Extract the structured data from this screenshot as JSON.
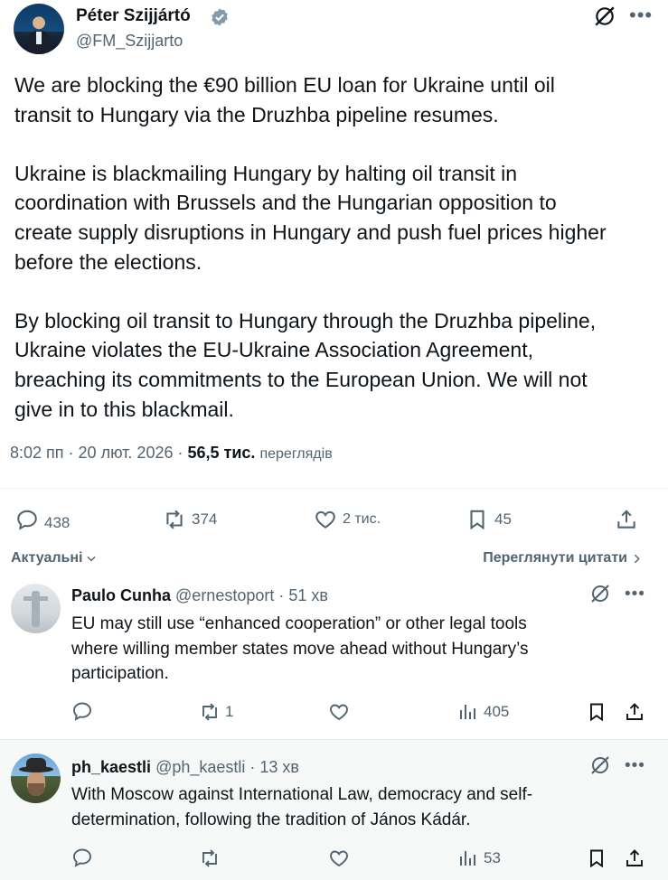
{
  "tweet": {
    "author_name": "Péter Szijjártó",
    "author_handle": "@FM_Szijjarto",
    "text": "We are blocking the €90 billion EU loan for Ukraine until oil\ntransit to Hungary via the Druzhba pipeline resumes.\n\nUkraine is blackmailing Hungary by halting oil transit in\ncoordination with Brussels and the Hungarian opposition to\ncreate supply disruptions in Hungary and push fuel prices higher\nbefore the elections.\n\nBy blocking oil transit to Hungary through the Druzhba pipeline,\nUkraine violates the EU-Ukraine Association Agreement,\nbreaching its commitments to the European Union. We will not\ngive in to this blackmail.",
    "time": "8:02 пп",
    "date": "20 лют. 2026",
    "views_count": "56,5 тис.",
    "views_label": "переглядів",
    "stats": {
      "replies": "438",
      "reposts": "374",
      "likes": "2 тис.",
      "bookmarks": "45"
    }
  },
  "sort": {
    "left_label": "Актуальні",
    "right_label": "Переглянути цитати"
  },
  "replies": [
    {
      "name": "Paulo Cunha",
      "handle": "@ernestoport",
      "age": "51 хв",
      "text": "EU may still use “enhanced cooperation” or other legal tools\nwhere willing member states move ahead without Hungary’s\nparticipation.",
      "reposts": "1",
      "views": "405"
    },
    {
      "name": "ph_kaestli",
      "handle": "@ph_kaestli",
      "age": "13 хв",
      "text": "With Moscow against International Law, democracy and self-\ndetermination, following the tradition of János Kádár.",
      "reposts": "",
      "views": "53"
    }
  ],
  "icons": [
    "verified-badge-icon",
    "grok-icon",
    "more-icon",
    "reply-icon",
    "repost-icon",
    "like-icon",
    "bookmark-icon",
    "share-icon",
    "views-icon",
    "chevron-down-icon",
    "chevron-right-icon"
  ],
  "colors": {
    "text": "#0f1419",
    "muted": "#536471",
    "divider": "#eff3f4"
  }
}
